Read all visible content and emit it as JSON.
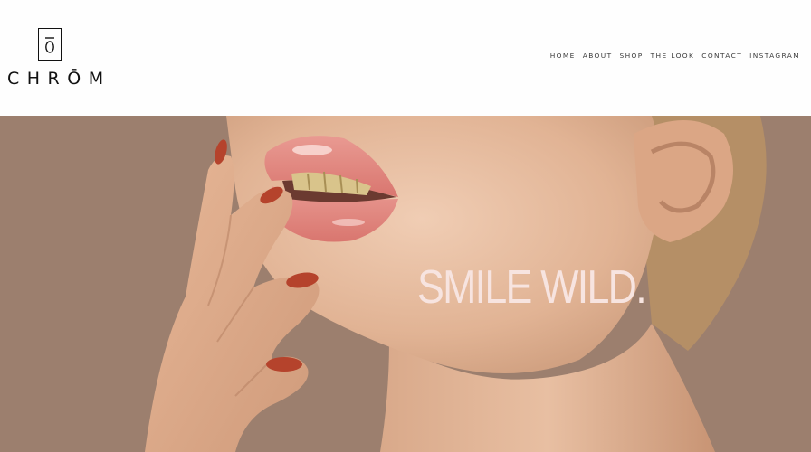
{
  "brand": {
    "name": "CHRŌM",
    "mark_letter": "Ō"
  },
  "nav": {
    "items": [
      "HOME",
      "ABOUT",
      "SHOP",
      "THE LOOK",
      "CONTACT",
      "INSTAGRAM"
    ]
  },
  "hero": {
    "headline": "SMILE WILD.",
    "image": "woman-lips-gold-grillz-photo"
  },
  "colors": {
    "hero_bg": "#9c7f6e",
    "headline": "#f7e4e0",
    "skin": "#e4b89a",
    "lips": "#e1857e",
    "nails": "#b5432c",
    "gold": "#d8c48a"
  }
}
